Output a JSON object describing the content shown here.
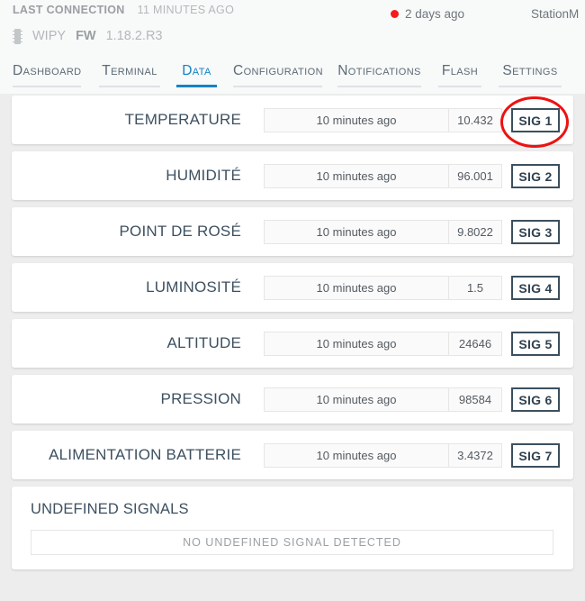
{
  "header": {
    "last_connection_label": "LAST CONNECTION",
    "last_connection_value": "11 MINUTES AGO",
    "chip_icon": "chip-icon",
    "device_name": "WIPY",
    "firmware_label": "FW",
    "firmware_version": "1.18.2.R3",
    "status_dot_color": "#f41b1b",
    "status_text": "2 days ago",
    "station_name": "StationM"
  },
  "tabs": {
    "active_index": 2,
    "items": [
      {
        "label": "Dashboard"
      },
      {
        "label": "Terminal"
      },
      {
        "label": "Data"
      },
      {
        "label": "Configuration"
      },
      {
        "label": "Notifications"
      },
      {
        "label": "Flash"
      },
      {
        "label": "Settings"
      }
    ]
  },
  "signals": [
    {
      "label": "TEMPERATURE",
      "time": "10 minutes ago",
      "value": "10.432",
      "badge": "SIG 1"
    },
    {
      "label": "HUMIDITÉ",
      "time": "10 minutes ago",
      "value": "96.001",
      "badge": "SIG 2"
    },
    {
      "label": "POINT DE ROSÉ",
      "time": "10 minutes ago",
      "value": "9.8022",
      "badge": "SIG 3"
    },
    {
      "label": "LUMINOSITÉ",
      "time": "10 minutes ago",
      "value": "1.5",
      "badge": "SIG 4"
    },
    {
      "label": "ALTITUDE",
      "time": "10 minutes ago",
      "value": "24646",
      "badge": "SIG 5"
    },
    {
      "label": "PRESSION",
      "time": "10 minutes ago",
      "value": "98584",
      "badge": "SIG 6"
    },
    {
      "label": "ALIMENTATION BATTERIE",
      "time": "10 minutes ago",
      "value": "3.4372",
      "badge": "SIG 7"
    }
  ],
  "undefined_section": {
    "title": "UNDEFINED SIGNALS",
    "empty_text": "NO UNDEFINED SIGNAL DETECTED"
  },
  "annotation": {
    "shape": "ellipse",
    "color": "#ee1111",
    "targets": "SIG 1"
  }
}
